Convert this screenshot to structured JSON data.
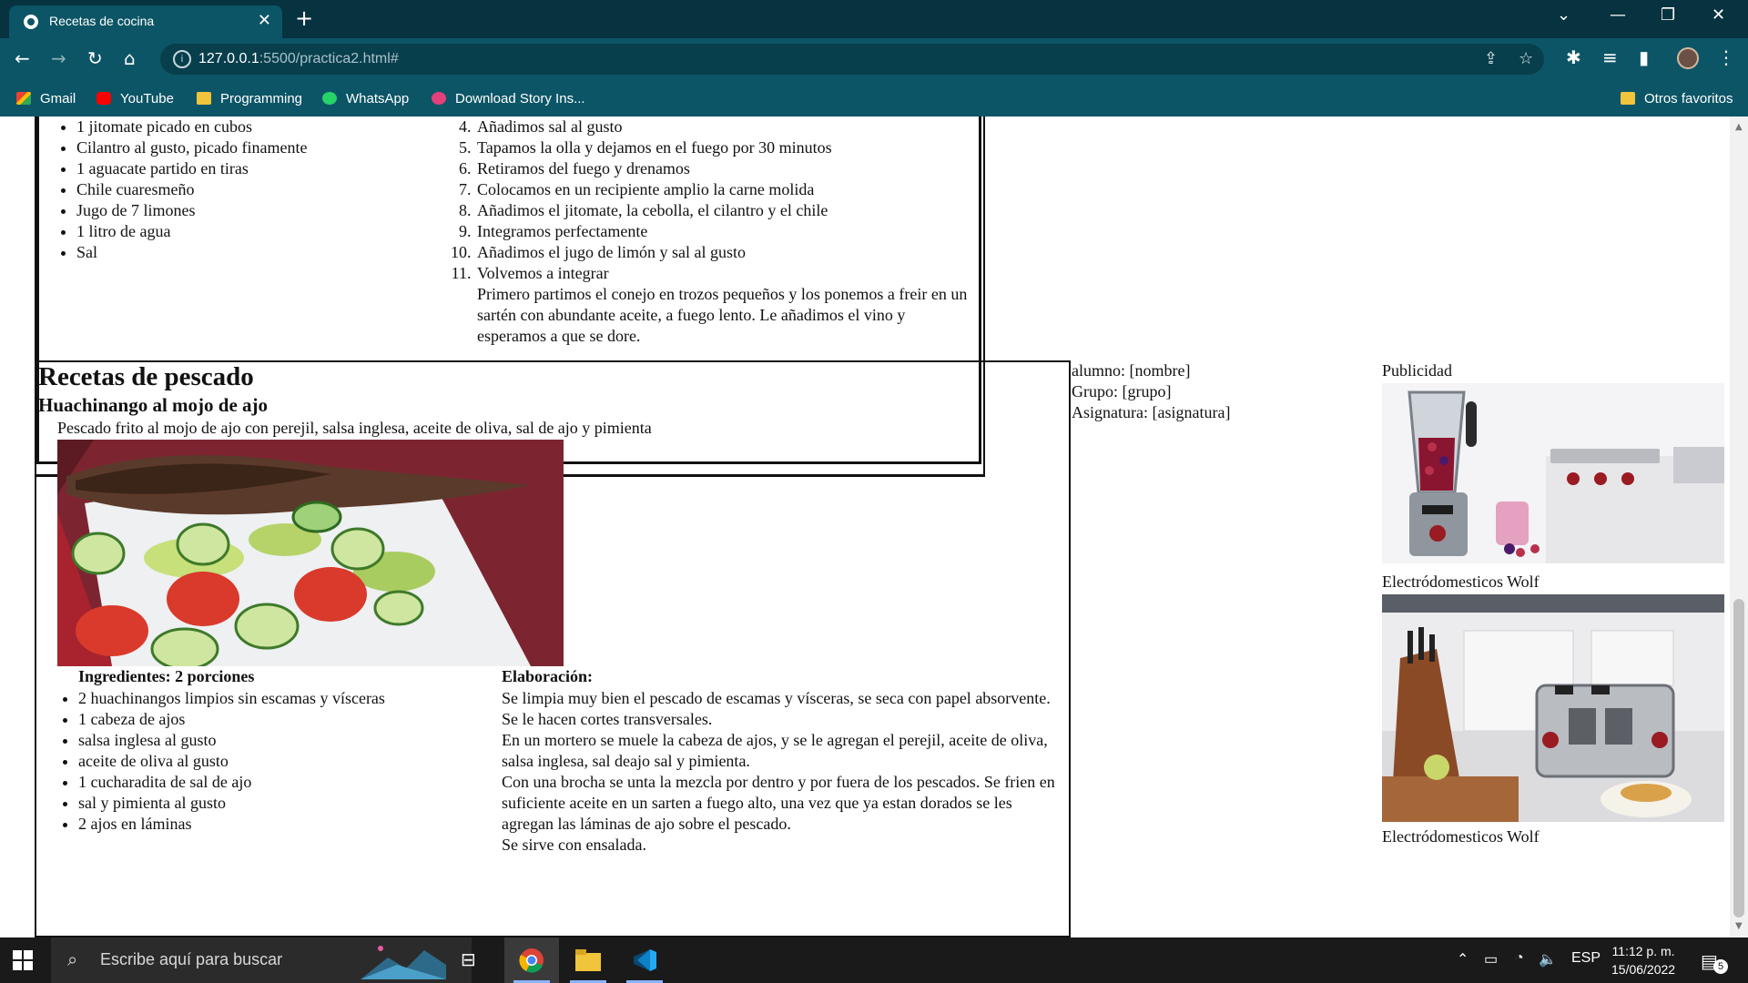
{
  "browser": {
    "tab_title": "Recetas de cocina",
    "tab_close": "✕",
    "new_tab": "+",
    "url_host": "127.0.0.1",
    "url_path": ":5500/practica2.html#",
    "bookmarks": [
      {
        "label": "Gmail"
      },
      {
        "label": "YouTube"
      },
      {
        "label": "Programming"
      },
      {
        "label": "WhatsApp"
      },
      {
        "label": "Download Story Ins..."
      }
    ],
    "other_favorites": "Otros favoritos"
  },
  "page": {
    "recipe1": {
      "ingredients": [
        "1 jitomate picado en cubos",
        "Cilantro al gusto, picado finamente",
        "1 aguacate partido en tiras",
        "Chile cuaresmeño",
        "Jugo de 7 limones",
        "1 litro de agua",
        "Sal"
      ],
      "steps": [
        "Añadimos sal al gusto",
        "Tapamos la olla y dejamos en el fuego por 30 minutos",
        "Retiramos del fuego y drenamos",
        "Colocamos en un recipiente amplio la carne molida",
        "Añadimos el jitomate, la cebolla, el cilantro y el chile",
        "Integramos perfectamente",
        "Añadimos el jugo de limón y sal al gusto",
        "Volvemos a integrar"
      ],
      "extra_paragraph": "Primero partimos el conejo en trozos pequeños y los ponemos a freir en un sartén con abundante aceite, a fuego lento. Le añadimos el vino y esperamos a que se dore."
    },
    "fish_section": {
      "heading": "Recetas de pescado",
      "recipe_title": "Huachinango al mojo de ajo",
      "description": "Pescado frito al mojo de ajo con perejil, salsa inglesa, aceite de oliva, sal de ajo y pimienta",
      "ingredients_title": "Ingredientes: 2 porciones",
      "ingredients": [
        "2 huachinangos limpios sin escamas y vísceras",
        "1 cabeza de ajos",
        "salsa inglesa al gusto",
        "aceite de oliva al gusto",
        "1 cucharadita de sal de ajo",
        "sal y pimienta al gusto",
        "2 ajos en láminas"
      ],
      "elaboration_title": "Elaboración:",
      "elaboration": [
        "Se limpia muy bien el pescado de escamas y vísceras, se seca con papel absorvente. Se le hacen cortes transversales.",
        "En un mortero se muele la cabeza de ajos, y se le agregan el perejil, aceite de oliva, salsa inglesa, sal deajo sal y pimienta.",
        "Con una brocha se unta la mezcla por dentro y por fuera de los pescados. Se frien en suficiente aceite en un sarten a fuego alto, una vez que ya estan dorados se les agregan las láminas de ajo sobre el pescado.",
        "Se sirve con ensalada."
      ]
    },
    "student": {
      "alumno": "alumno: [nombre]",
      "grupo": "Grupo: [grupo]",
      "asignatura": "Asignatura: [asignatura]"
    },
    "ads": {
      "title": "Publicidad",
      "caption1": "Electródomesticos Wolf",
      "caption2": "Electródomesticos Wolf"
    }
  },
  "taskbar": {
    "search_placeholder": "Escribe aquí para buscar",
    "lang": "ESP",
    "time": "11:12 p. m.",
    "date": "15/06/2022",
    "notifications": "5"
  }
}
